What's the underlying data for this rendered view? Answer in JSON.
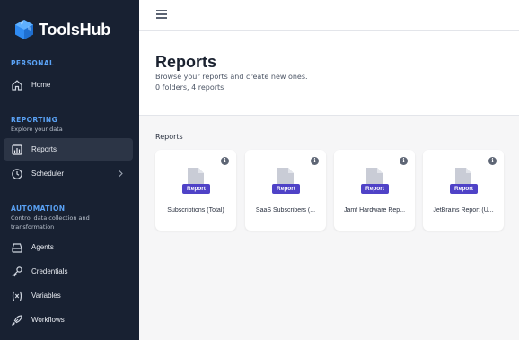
{
  "app": {
    "name": "ToolsHub"
  },
  "sidebar": {
    "sections": [
      {
        "title": "PERSONAL",
        "subtitle": ""
      },
      {
        "title": "REPORTING",
        "subtitle": "Explore your data"
      },
      {
        "title": "AUTOMATION",
        "subtitle": "Control data collection and transformation"
      }
    ],
    "items": [
      {
        "label": "Home",
        "icon": "home-icon",
        "active": false
      },
      {
        "label": "Reports",
        "icon": "chart-icon",
        "active": true
      },
      {
        "label": "Scheduler",
        "icon": "clock-icon",
        "active": false
      },
      {
        "label": "Agents",
        "icon": "server-icon",
        "active": false
      },
      {
        "label": "Credentials",
        "icon": "key-icon",
        "active": false
      },
      {
        "label": "Variables",
        "icon": "variable-icon",
        "active": false
      },
      {
        "label": "Workflows",
        "icon": "rocket-icon",
        "active": false
      }
    ]
  },
  "header": {
    "title": "Reports",
    "subtitle": "Browse your reports and create new ones.",
    "counts": "0 folders, 4 reports"
  },
  "content": {
    "section_label": "Reports",
    "cards": [
      {
        "title": "Subscriptions (Total)",
        "badge": "Report"
      },
      {
        "title": "SaaS Subscribers (...",
        "badge": "Report"
      },
      {
        "title": "Jamf Hardware Rep...",
        "badge": "Report"
      },
      {
        "title": "JetBrains Report (U...",
        "badge": "Report"
      }
    ]
  },
  "colors": {
    "sidebar_bg": "#182132",
    "accent_blue": "#5aa2f5",
    "badge_purple": "#4f42c7",
    "logo_blue": "#2f8bf2"
  },
  "info_glyph": "i"
}
